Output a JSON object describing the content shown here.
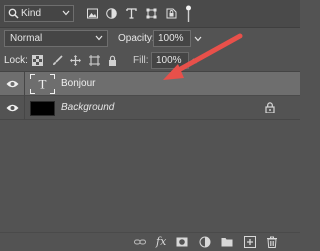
{
  "filter": {
    "kind_label": "Kind",
    "search_icon": "search-icon",
    "icons": [
      "image-filter-icon",
      "adjustment-filter-icon",
      "type-filter-icon",
      "shape-filter-icon",
      "smart-object-filter-icon"
    ]
  },
  "blend": {
    "mode": "Normal",
    "opacity_label": "Opacity:",
    "opacity_value": "100%"
  },
  "lock": {
    "label": "Lock:",
    "icons": [
      "lock-transparent-pixels-icon",
      "lock-image-pixels-icon",
      "lock-position-icon",
      "lock-artboard-icon",
      "lock-all-icon"
    ],
    "fill_label": "Fill:",
    "fill_value": "100%"
  },
  "layers": [
    {
      "name": "Bonjour",
      "type": "text",
      "selected": true,
      "thumb_letter": "T"
    },
    {
      "name": "Background",
      "type": "background",
      "selected": false,
      "locked": true
    }
  ],
  "bottom_bar": {
    "fx_label": "fx",
    "icons": [
      "link-layers-icon",
      "layer-style-icon",
      "add-mask-icon",
      "adjustment-layer-icon",
      "new-group-icon",
      "new-layer-icon",
      "delete-layer-icon"
    ]
  },
  "colors": {
    "panel_bg": "#535353",
    "selected_row": "#6e6e6e",
    "annotation_arrow": "#e8504a"
  }
}
